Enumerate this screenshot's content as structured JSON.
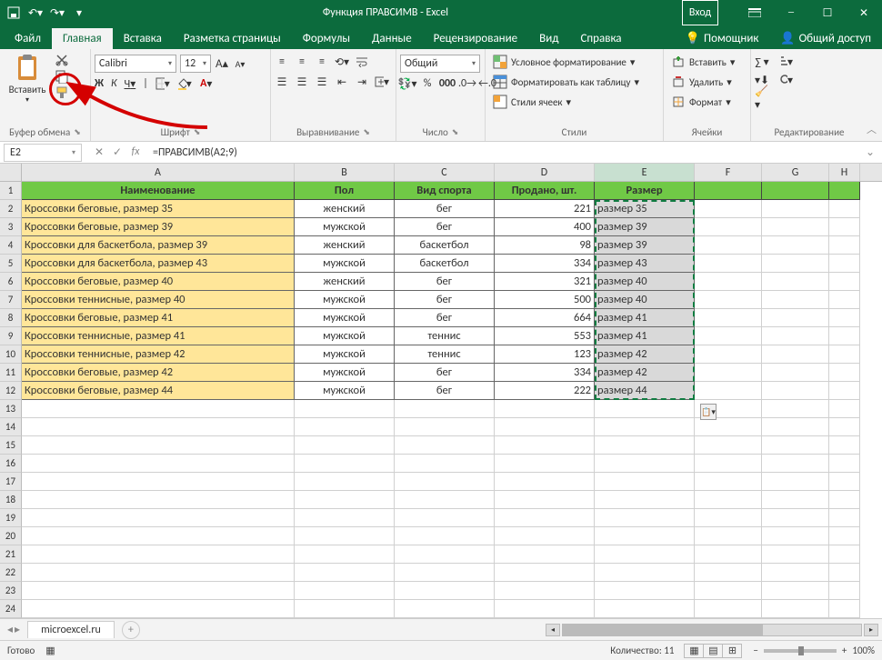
{
  "titlebar": {
    "title": "Функция ПРАВСИМВ  -  Excel",
    "login": "Вход"
  },
  "tabs": {
    "file": "Файл",
    "home": "Главная",
    "insert": "Вставка",
    "layout": "Разметка страницы",
    "formulas": "Формулы",
    "data": "Данные",
    "review": "Рецензирование",
    "view": "Вид",
    "help": "Справка",
    "tellme": "Помощник",
    "share": "Общий доступ"
  },
  "ribbon": {
    "paste_label": "Вставить",
    "clipboard": "Буфер обмена",
    "font_name": "Calibri",
    "font_size": "12",
    "bold": "Ж",
    "italic": "К",
    "underline": "Ч",
    "font": "Шрифт",
    "alignment": "Выравнивание",
    "number_format": "Общий",
    "number": "Число",
    "cond_fmt": "Условное форматирование",
    "table_fmt": "Форматировать как таблицу",
    "cell_styles": "Стили ячеек",
    "styles": "Стили",
    "insert_cells": "Вставить",
    "delete_cells": "Удалить",
    "format_cells": "Формат",
    "cells": "Ячейки",
    "editing": "Редактирование"
  },
  "formula_bar": {
    "cell_ref": "E2",
    "formula": "=ПРАВСИМВ(A2;9)"
  },
  "columns": [
    "A",
    "B",
    "C",
    "D",
    "E",
    "F",
    "G",
    "H"
  ],
  "headers": {
    "A": "Наименование",
    "B": "Пол",
    "C": "Вид спорта",
    "D": "Продано, шт.",
    "E": "Размер"
  },
  "rows": [
    {
      "A": "Кроссовки беговые, размер 35",
      "B": "женский",
      "C": "бег",
      "D": "221",
      "E": "размер 35"
    },
    {
      "A": "Кроссовки беговые, размер 39",
      "B": "мужской",
      "C": "бег",
      "D": "400",
      "E": "размер 39"
    },
    {
      "A": "Кроссовки для баскетбола, размер 39",
      "B": "женский",
      "C": "баскетбол",
      "D": "98",
      "E": "размер 39"
    },
    {
      "A": "Кроссовки для баскетбола, размер 43",
      "B": "мужской",
      "C": "баскетбол",
      "D": "334",
      "E": "размер 43"
    },
    {
      "A": "Кроссовки беговые, размер 40",
      "B": "женский",
      "C": "бег",
      "D": "321",
      "E": "размер 40"
    },
    {
      "A": "Кроссовки теннисные, размер 40",
      "B": "мужской",
      "C": "бег",
      "D": "500",
      "E": "размер 40"
    },
    {
      "A": "Кроссовки беговые, размер 41",
      "B": "мужской",
      "C": "бег",
      "D": "664",
      "E": "размер 41"
    },
    {
      "A": "Кроссовки теннисные, размер 41",
      "B": "мужской",
      "C": "теннис",
      "D": "553",
      "E": "размер 41"
    },
    {
      "A": "Кроссовки теннисные, размер 42",
      "B": "мужской",
      "C": "теннис",
      "D": "123",
      "E": "размер 42"
    },
    {
      "A": "Кроссовки беговые, размер 42",
      "B": "мужской",
      "C": "бег",
      "D": "334",
      "E": "размер 42"
    },
    {
      "A": "Кроссовки беговые, размер 44",
      "B": "мужской",
      "C": "бег",
      "D": "222",
      "E": "размер 44"
    }
  ],
  "empty_rows": [
    13,
    14,
    15,
    16,
    17,
    18,
    19,
    20,
    21,
    22,
    23,
    24
  ],
  "sheet": {
    "name": "microexcel.ru"
  },
  "status": {
    "ready": "Готово",
    "count_label": "Количество:",
    "count": "11",
    "zoom": "100%"
  }
}
